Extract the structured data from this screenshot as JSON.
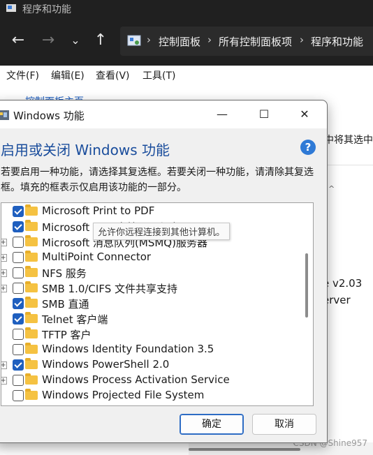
{
  "explorer": {
    "window_title": "程序和功能",
    "breadcrumbs": [
      "控制面板",
      "所有控制面板项",
      "程序和功能"
    ],
    "menu": [
      "文件(F)",
      "编辑(E)",
      "查看(V)",
      "工具(T)"
    ],
    "partial_link": "控制面板主页",
    "partial_right_1": "中将其选中，",
    "partial_right_2": "e v2.03",
    "partial_right_3": "erver"
  },
  "dialog": {
    "title": "Windows 功能",
    "heading": "启用或关闭 Windows 功能",
    "description": "若要启用一种功能，请选择其复选框。若要关闭一种功能，请清除其复选框。填充的框表示仅启用该功能的一部分。",
    "features": [
      {
        "label": "Microsoft Print to PDF",
        "checked": true,
        "expandable": false
      },
      {
        "label": "Microsoft XPS 文档写入程序",
        "checked": true,
        "expandable": false
      },
      {
        "label": "Microsoft 消息队列(MSMQ)服务器",
        "checked": false,
        "expandable": true
      },
      {
        "label": "MultiPoint Connector",
        "checked": false,
        "expandable": true
      },
      {
        "label": "NFS 服务",
        "checked": false,
        "expandable": true
      },
      {
        "label": "SMB 1.0/CIFS 文件共享支持",
        "checked": false,
        "expandable": true
      },
      {
        "label": "SMB 直通",
        "checked": true,
        "expandable": false
      },
      {
        "label": "Telnet 客户端",
        "checked": true,
        "expandable": false
      },
      {
        "label": "TFTP 客户",
        "checked": false,
        "expandable": false
      },
      {
        "label": "Windows Identity Foundation 3.5",
        "checked": false,
        "expandable": false
      },
      {
        "label": "Windows PowerShell 2.0",
        "checked": true,
        "expandable": true
      },
      {
        "label": "Windows Process Activation Service",
        "checked": false,
        "expandable": true
      },
      {
        "label": "Windows Projected File System",
        "checked": false,
        "expandable": false
      }
    ],
    "tooltip": "允许你远程连接到其他计算机。",
    "ok_label": "确定",
    "cancel_label": "取消"
  },
  "watermark": "CSDN @Shine957",
  "colors": {
    "accent": "#1f5fbf",
    "heading": "#1a4d9c",
    "folder": "#f5c242"
  }
}
